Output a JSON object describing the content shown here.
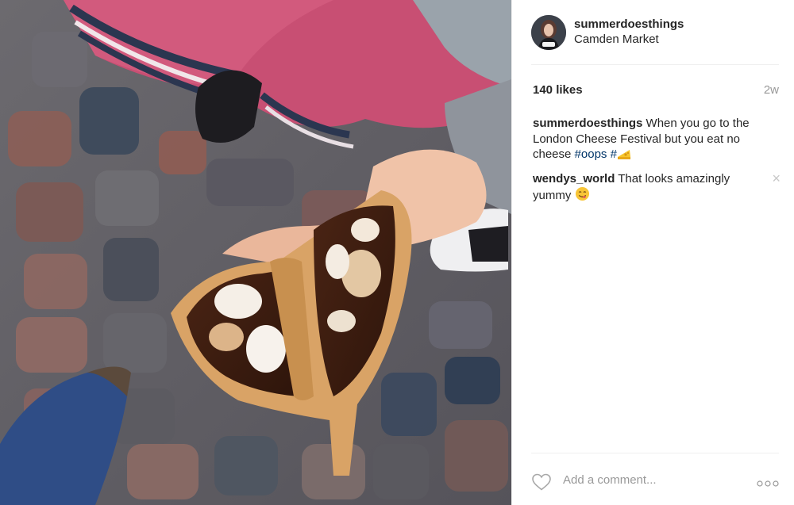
{
  "post": {
    "username": "summerdoesthings",
    "location": "Camden Market",
    "likes": "140 likes",
    "time_ago": "2w"
  },
  "caption": {
    "user": "summerdoesthings",
    "text": "When you go to the London Cheese Festival but you eat no cheese",
    "hashtag1": "#oops",
    "hashtag2": "#",
    "hashtag2_emoji": "cheese-emoji"
  },
  "comment": {
    "user": "wendys_world",
    "text": "That looks amazingly yummy",
    "emoji": "yum-face-emoji"
  },
  "footer": {
    "add_comment_placeholder": "Add a comment...",
    "heart_icon": "heart-outline-icon",
    "more_icon": "more-options-icon"
  },
  "photo": {
    "subject": "photo-crepe-in-hand"
  }
}
